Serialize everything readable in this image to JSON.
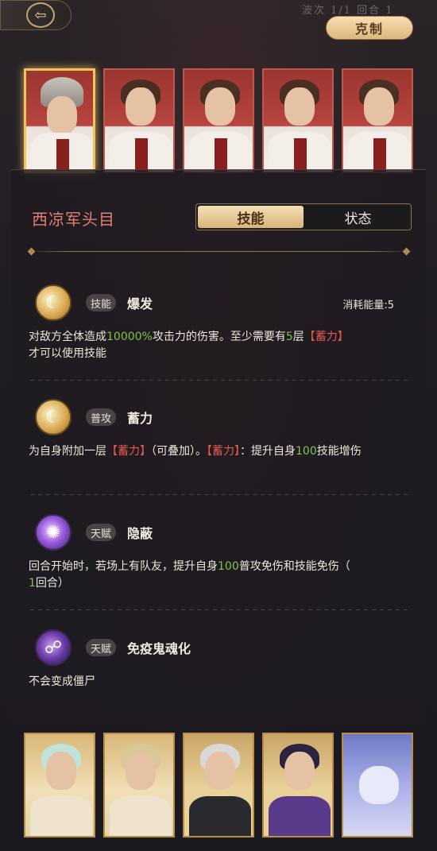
{
  "topbar": {
    "back_icon": "back-arrow-icon",
    "wave_text": "波次 1/1 回合 1",
    "restrain_label": "克制"
  },
  "enemy_portraits": [
    {
      "name": "西凉军头目",
      "selected": true,
      "type": "helmet"
    },
    {
      "name": "",
      "selected": false,
      "type": "hair"
    },
    {
      "name": "",
      "selected": false,
      "type": "hair"
    },
    {
      "name": "",
      "selected": false,
      "type": "hair"
    },
    {
      "name": "",
      "selected": false,
      "type": "hair"
    }
  ],
  "unit": {
    "name": "西凉军头目"
  },
  "tabs": {
    "skills": "技能",
    "status": "状态"
  },
  "skills": [
    {
      "tag": "技能",
      "name": "爆发",
      "cost": "消耗能量:5",
      "desc_parts": [
        "对敌方全体造成",
        "10000%",
        "攻击力的伤害。至少需要有",
        "5",
        "层",
        "【蓄力】",
        "才可以使用技能"
      ]
    },
    {
      "tag": "普攻",
      "name": "蓄力",
      "desc_parts": [
        "为自身附加一层",
        "【蓄力】",
        "（可叠加）。",
        "【蓄力】",
        "：提升自身",
        "100",
        "技能增伤"
      ]
    },
    {
      "tag": "天赋",
      "name": "隐蔽",
      "desc_parts": [
        "回合开始时，若场上有队友，提升自身",
        "100",
        "普攻免伤和技能免伤（",
        "1",
        "回合）"
      ]
    },
    {
      "tag": "天赋",
      "name": "免疫鬼魂化",
      "desc_parts": [
        "不会变成僵尸"
      ]
    }
  ],
  "ally_portraits": [
    {
      "name": "",
      "theme": "gold"
    },
    {
      "name": "",
      "theme": "gold"
    },
    {
      "name": "",
      "theme": "dark"
    },
    {
      "name": "",
      "theme": "dark"
    },
    {
      "name": "",
      "theme": "purple"
    }
  ],
  "colors": {
    "accent_gold": "#d8b47a",
    "name_red": "#e07f6f",
    "highlight_green": "#7cc44a",
    "highlight_red": "#e8594b"
  }
}
